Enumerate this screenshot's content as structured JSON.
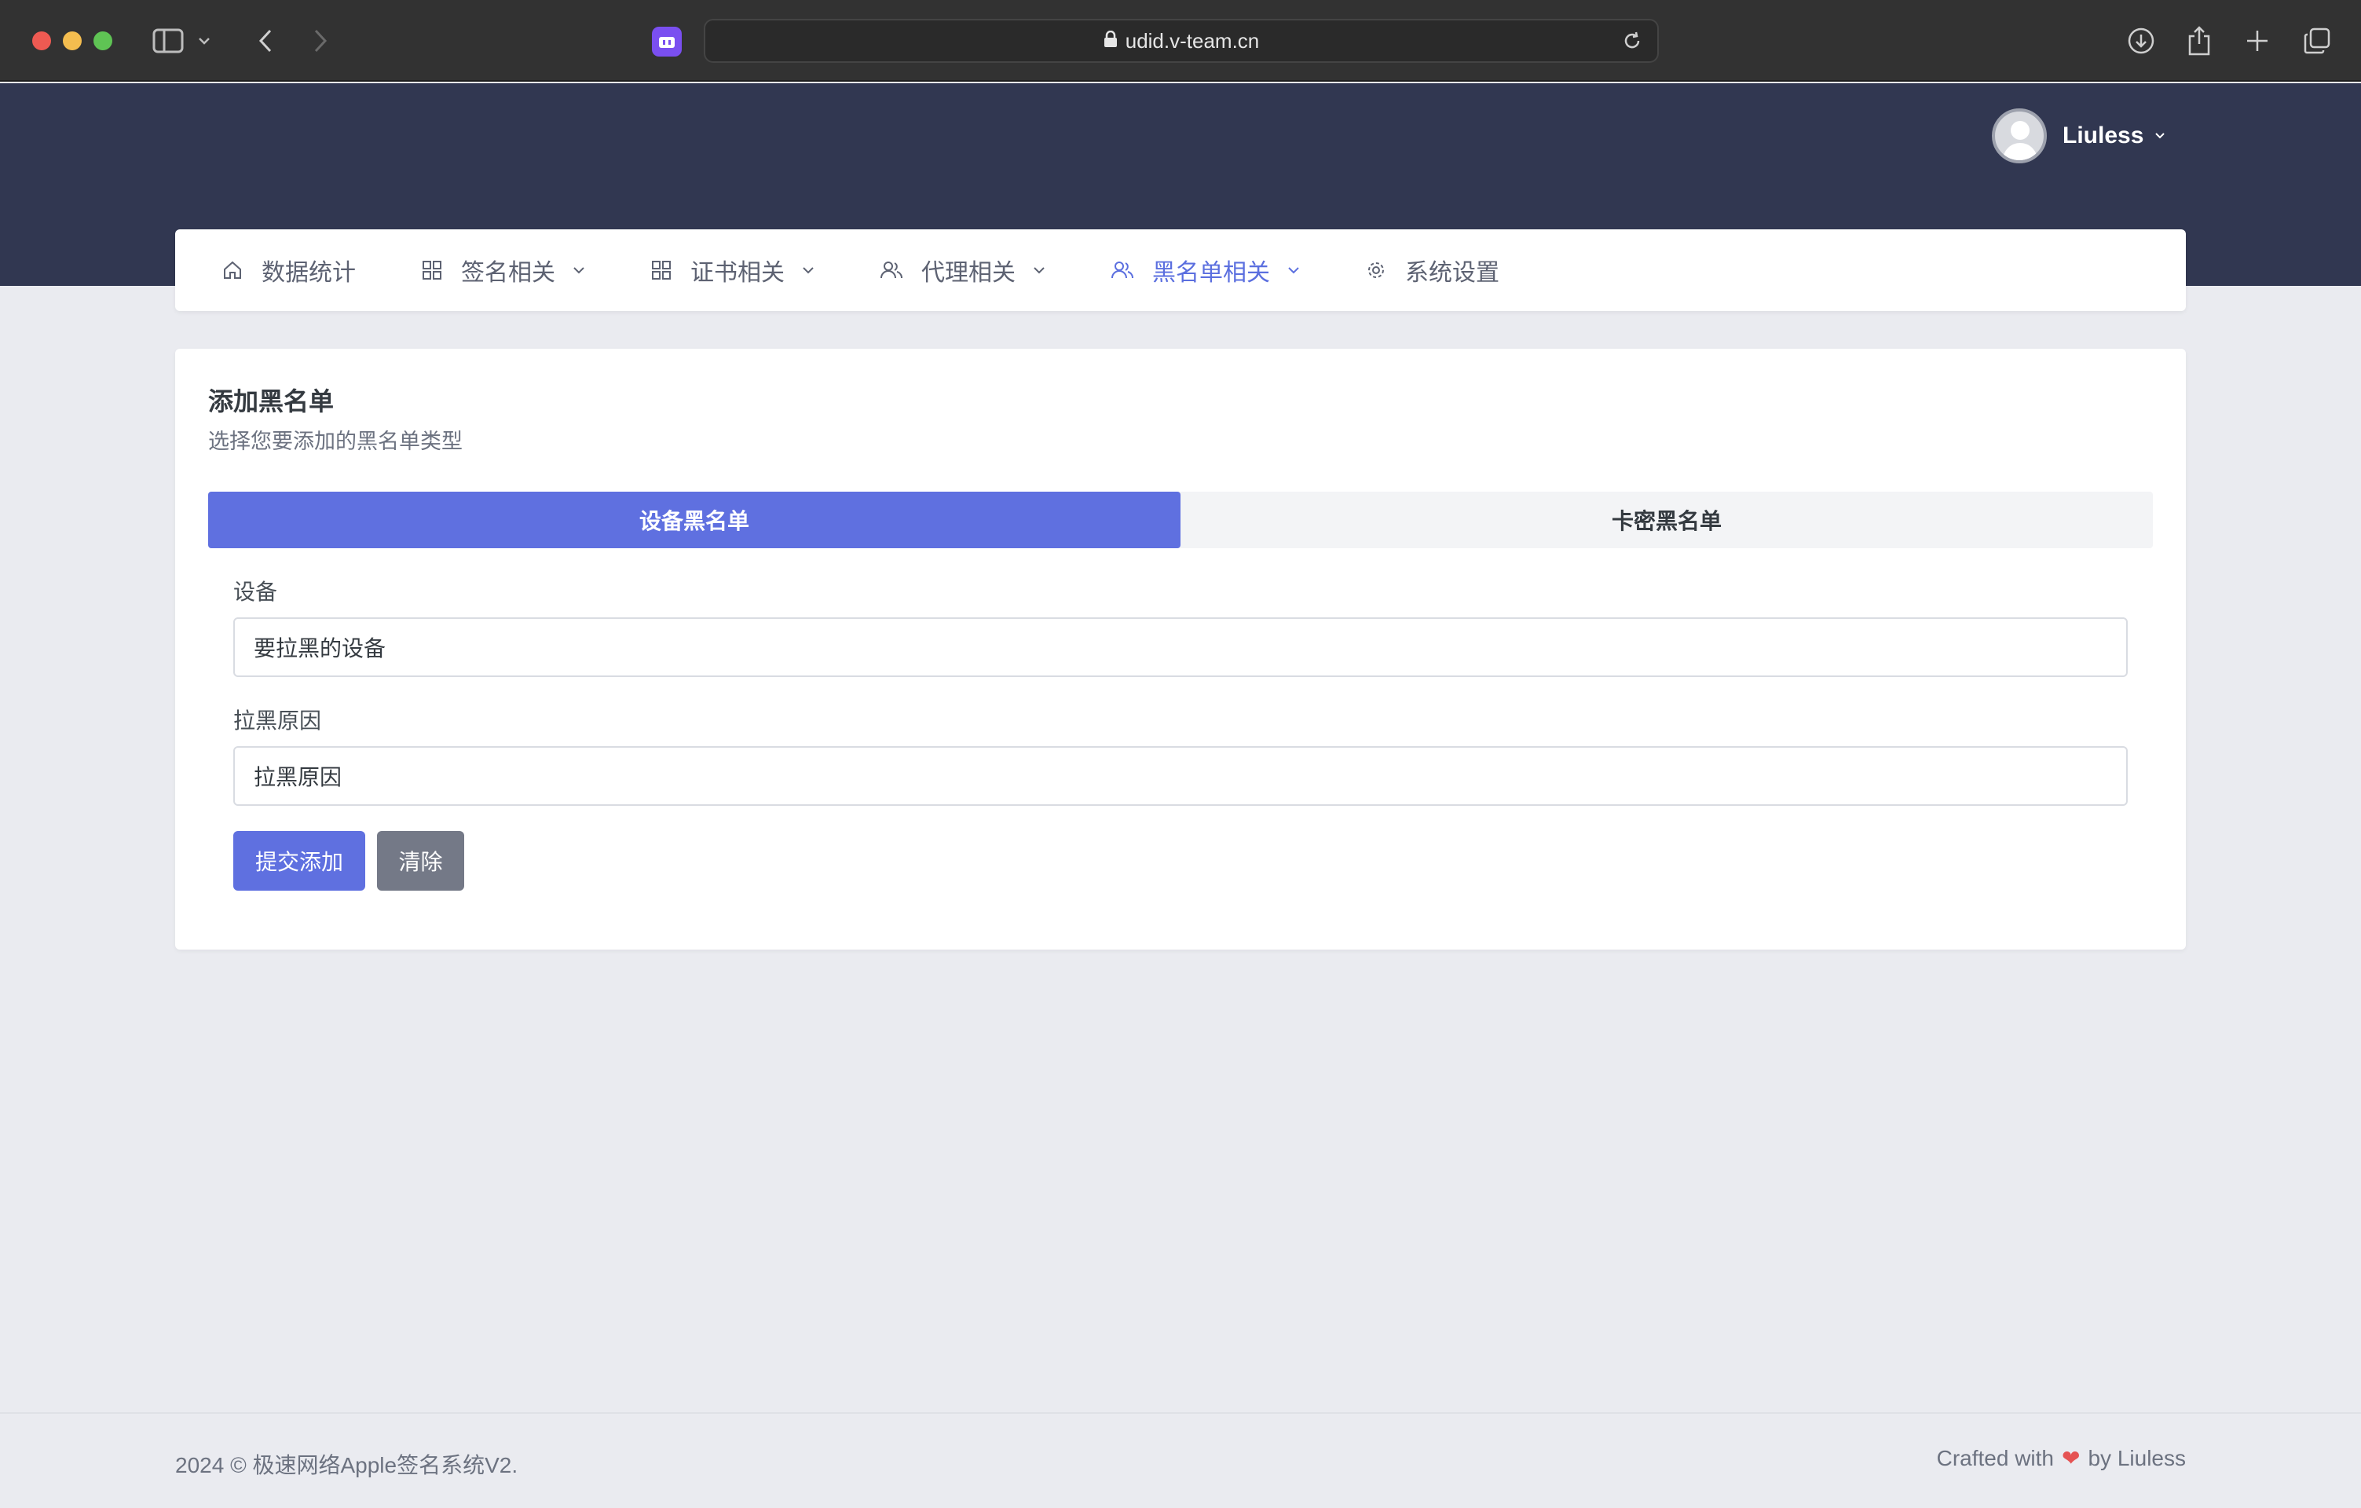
{
  "browser": {
    "url": "udid.v-team.cn"
  },
  "header": {
    "username": "Liuless"
  },
  "nav": {
    "items": [
      {
        "label": "数据统计",
        "icon": "home-icon",
        "has_dropdown": false
      },
      {
        "label": "签名相关",
        "icon": "grid-icon",
        "has_dropdown": true
      },
      {
        "label": "证书相关",
        "icon": "grid-icon",
        "has_dropdown": true
      },
      {
        "label": "代理相关",
        "icon": "users-icon",
        "has_dropdown": true
      },
      {
        "label": "黑名单相关",
        "icon": "users-icon",
        "has_dropdown": true,
        "active": true
      },
      {
        "label": "系统设置",
        "icon": "gear-icon",
        "has_dropdown": false
      }
    ]
  },
  "card": {
    "title": "添加黑名单",
    "subtitle": "选择您要添加的黑名单类型",
    "tabs": [
      {
        "label": "设备黑名单",
        "active": true
      },
      {
        "label": "卡密黑名单",
        "active": false
      }
    ],
    "device_label": "设备",
    "device_placeholder": "要拉黑的设备",
    "reason_label": "拉黑原因",
    "reason_placeholder": "拉黑原因",
    "submit_label": "提交添加",
    "clear_label": "清除"
  },
  "footer": {
    "copyright": "2024 © 极速网络Apple签名系统V2.",
    "crafted_prefix": "Crafted with",
    "crafted_suffix": "by Liuless"
  },
  "colors": {
    "accent": "#5f70e0",
    "header_bg": "#313751",
    "page_bg": "#eaebf0",
    "heart": "#e55353"
  }
}
